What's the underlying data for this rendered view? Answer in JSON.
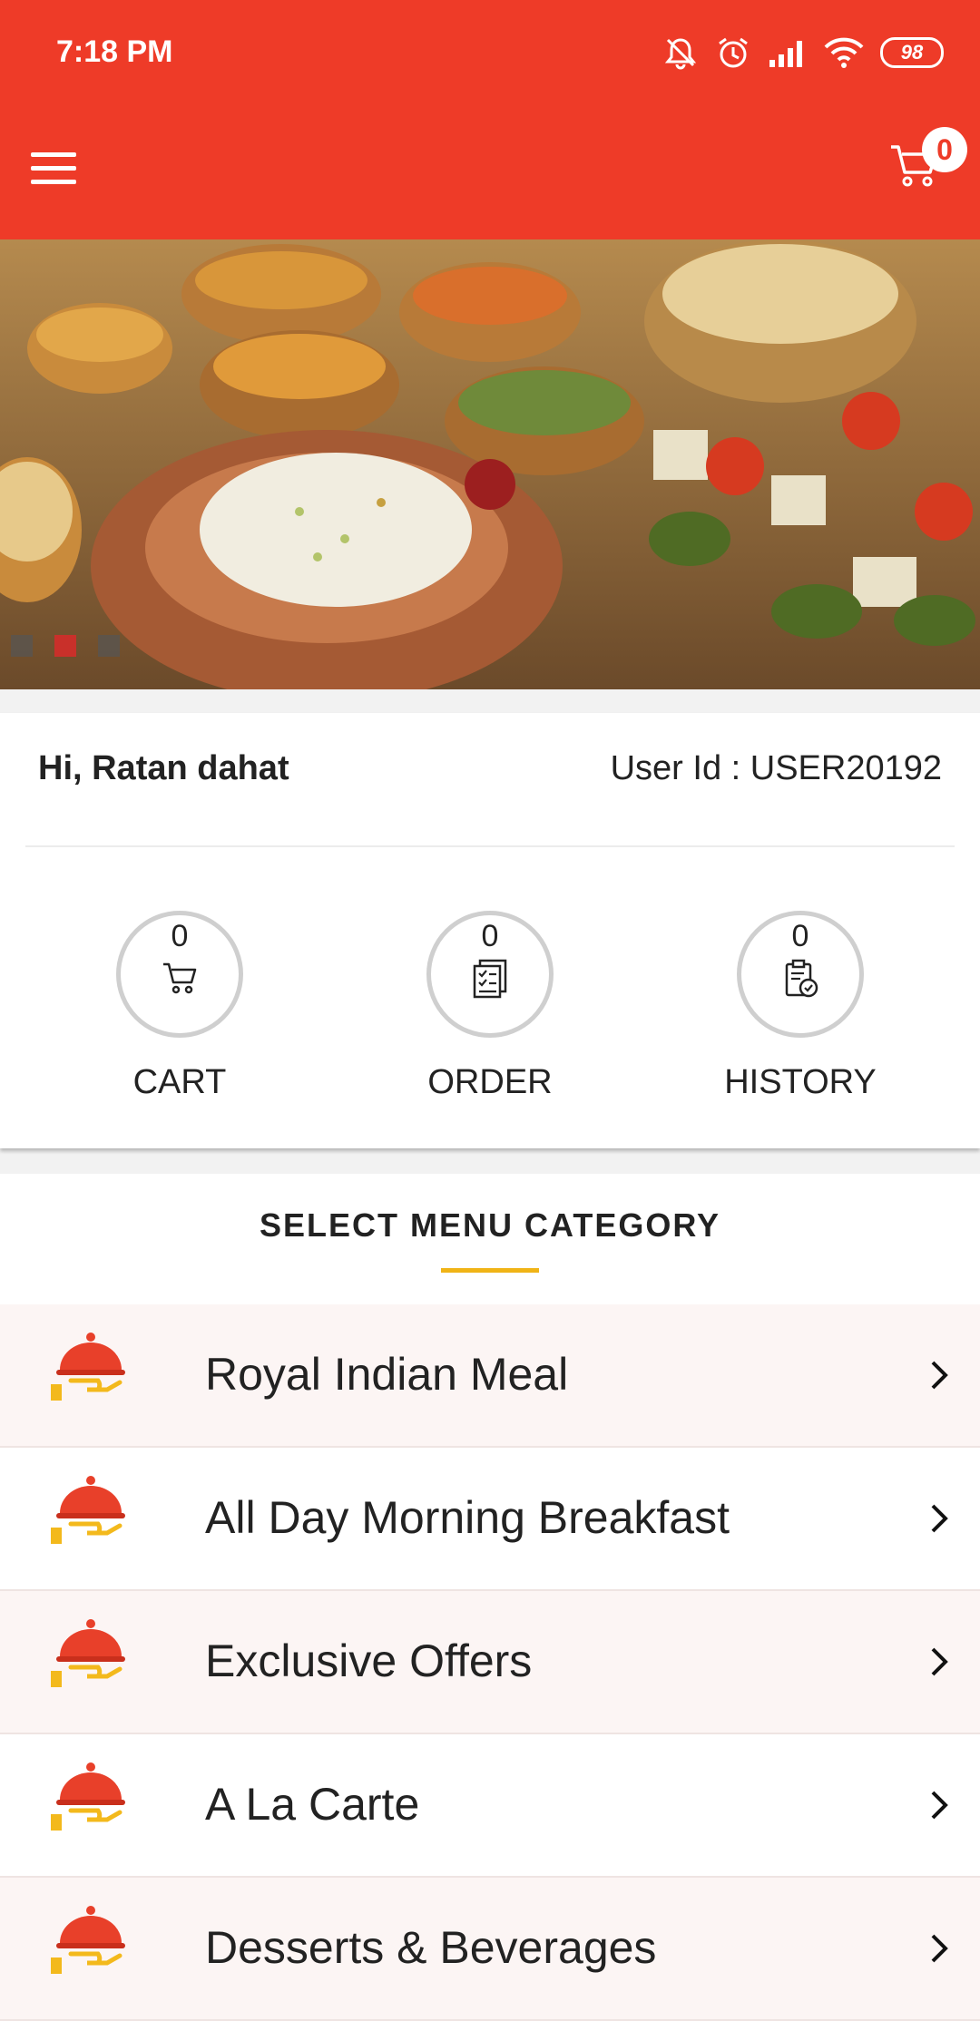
{
  "status_bar": {
    "time": "7:18 PM",
    "battery": "98"
  },
  "app_bar": {
    "cart_count": "0"
  },
  "banner": {
    "slide_count": 3,
    "active_slide": 2
  },
  "user": {
    "greeting": "Hi, Ratan dahat",
    "user_id": "User Id : USER20192"
  },
  "stats": [
    {
      "count": "0",
      "label": "CART",
      "icon": "cart-icon"
    },
    {
      "count": "0",
      "label": "ORDER",
      "icon": "order-list-icon"
    },
    {
      "count": "0",
      "label": "HISTORY",
      "icon": "history-clipboard-icon"
    }
  ],
  "menu": {
    "title": "SELECT MENU CATEGORY",
    "items": [
      {
        "label": "Royal Indian Meal",
        "icon": "serving-cloche-icon"
      },
      {
        "label": "All Day Morning Breakfast",
        "icon": "serving-cloche-icon"
      },
      {
        "label": "Exclusive Offers",
        "icon": "serving-cloche-icon"
      },
      {
        "label": "A La Carte",
        "icon": "serving-cloche-icon"
      },
      {
        "label": "Desserts & Beverages",
        "icon": "serving-cloche-icon"
      }
    ]
  },
  "colors": {
    "primary": "#ee3b28",
    "accent": "#f0b416",
    "row_tint": "#fcf5f4"
  }
}
